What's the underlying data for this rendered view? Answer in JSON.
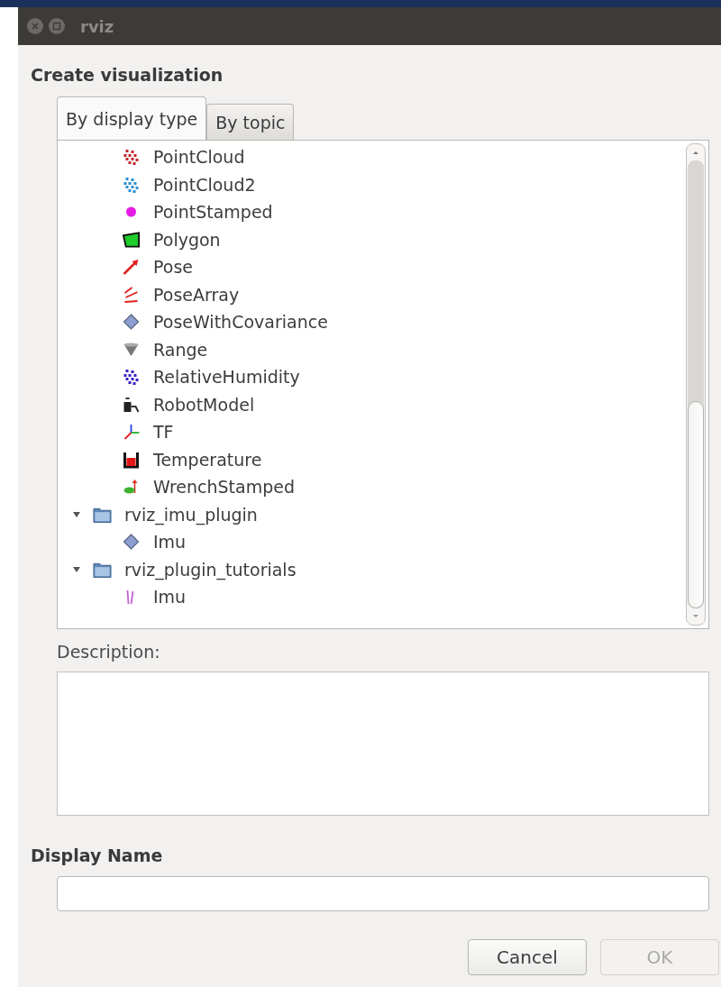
{
  "window": {
    "title": "rviz"
  },
  "heading": "Create visualization",
  "tabs": [
    {
      "label": "By display type",
      "selected": true
    },
    {
      "label": "By topic",
      "selected": false
    }
  ],
  "tree": [
    {
      "label": "PointCloud",
      "kind": "pointcloud",
      "color": "#c0282d"
    },
    {
      "label": "PointCloud2",
      "kind": "pointcloud",
      "color": "#2a8fd4"
    },
    {
      "label": "PointStamped",
      "kind": "point"
    },
    {
      "label": "Polygon",
      "kind": "polygon"
    },
    {
      "label": "Pose",
      "kind": "pose"
    },
    {
      "label": "PoseArray",
      "kind": "posearray"
    },
    {
      "label": "PoseWithCovariance",
      "kind": "diamond"
    },
    {
      "label": "Range",
      "kind": "range"
    },
    {
      "label": "RelativeHumidity",
      "kind": "pointcloud",
      "color": "#3b1fc4"
    },
    {
      "label": "RobotModel",
      "kind": "robot"
    },
    {
      "label": "TF",
      "kind": "tf"
    },
    {
      "label": "Temperature",
      "kind": "temperature"
    },
    {
      "label": "WrenchStamped",
      "kind": "wrench"
    },
    {
      "label": "rviz_imu_plugin",
      "kind": "folder",
      "expanded": true,
      "children": [
        {
          "label": "Imu",
          "kind": "diamond"
        }
      ]
    },
    {
      "label": "rviz_plugin_tutorials",
      "kind": "folder",
      "expanded": true,
      "children": [
        {
          "label": "Imu",
          "kind": "imu"
        }
      ]
    }
  ],
  "description": {
    "label": "Description:"
  },
  "display_name": {
    "label": "Display Name"
  },
  "buttons": [
    {
      "label": "Cancel",
      "disabled": false
    },
    {
      "label": "OK",
      "disabled": true
    }
  ]
}
